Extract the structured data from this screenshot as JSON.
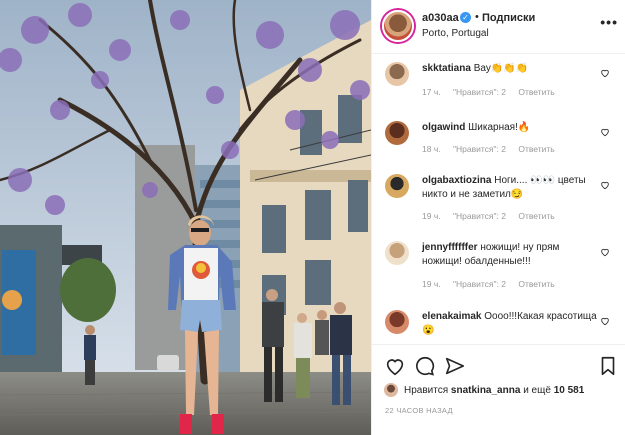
{
  "post": {
    "username": "a030aa",
    "follow_label": "Подписки",
    "location": "Porto, Portugal",
    "more_label": "•••"
  },
  "comments": [
    {
      "user": "skktatiana",
      "text": "Вау👏👏👏",
      "time": "17 ч.",
      "likes": "\"Нравится\": 2",
      "reply": "Ответить"
    },
    {
      "user": "olgawind",
      "text": "Шикарная!🔥",
      "time": "18 ч.",
      "likes": "\"Нравится\": 2",
      "reply": "Ответить"
    },
    {
      "user": "olgabaxtiozina",
      "text": "Ноги.... 👀👀 цветы никто и не заметил😏",
      "time": "19 ч.",
      "likes": "\"Нравится\": 2",
      "reply": "Ответить"
    },
    {
      "user": "jennyffffffer",
      "text": "ножищи! ну прям ножищи! обалденные!!!",
      "time": "19 ч.",
      "likes": "\"Нравится\": 2",
      "reply": "Ответить"
    },
    {
      "user": "elenakaimak",
      "text": "Оооо!!!Какая красотища😮",
      "time": "",
      "likes": "",
      "reply": ""
    }
  ],
  "likes": {
    "prefix": "Нравится",
    "user": "snatkina_anna",
    "suffix": "и ещё",
    "count": "10 581"
  },
  "time_ago": "22 ЧАСОВ НАЗАД",
  "icons": {
    "like": "heart-icon",
    "comment": "comment-icon",
    "share": "share-icon",
    "save": "bookmark-icon"
  }
}
